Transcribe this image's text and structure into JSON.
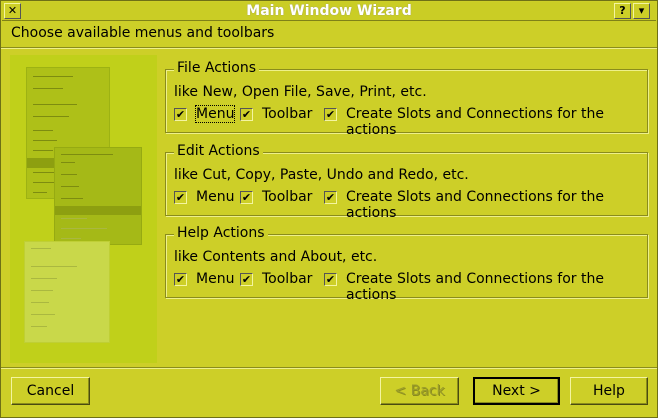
{
  "window": {
    "title": "Main Window Wizard",
    "help_button": "?",
    "menu_button": "▾",
    "close_button": "✕"
  },
  "page": {
    "subtitle": "Choose available menus and toolbars"
  },
  "groups": [
    {
      "title": "File Actions",
      "description": "like New, Open File, Save, Print, etc.",
      "menu_label": "Menu",
      "menu_checked": true,
      "toolbar_label": "Toolbar",
      "toolbar_checked": true,
      "slots_label": "Create Slots and Connections for the actions",
      "slots_checked": true
    },
    {
      "title": "Edit Actions",
      "description": "like Cut, Copy, Paste, Undo and Redo, etc.",
      "menu_label": "Menu",
      "menu_checked": true,
      "toolbar_label": "Toolbar",
      "toolbar_checked": true,
      "slots_label": "Create Slots and Connections for the actions",
      "slots_checked": true
    },
    {
      "title": "Help Actions",
      "description": "like Contents and About, etc.",
      "menu_label": "Menu",
      "menu_checked": true,
      "toolbar_label": "Toolbar",
      "toolbar_checked": true,
      "slots_label": "Create Slots and Connections for the actions",
      "slots_checked": true
    }
  ],
  "buttons": {
    "cancel": "Cancel",
    "back": "< Back",
    "next": "Next >",
    "help": "Help"
  },
  "colors": {
    "background": "#cdcf28",
    "title_bar": "#cacd25",
    "illustration": "#c0d01a"
  },
  "check_mark": "✔"
}
